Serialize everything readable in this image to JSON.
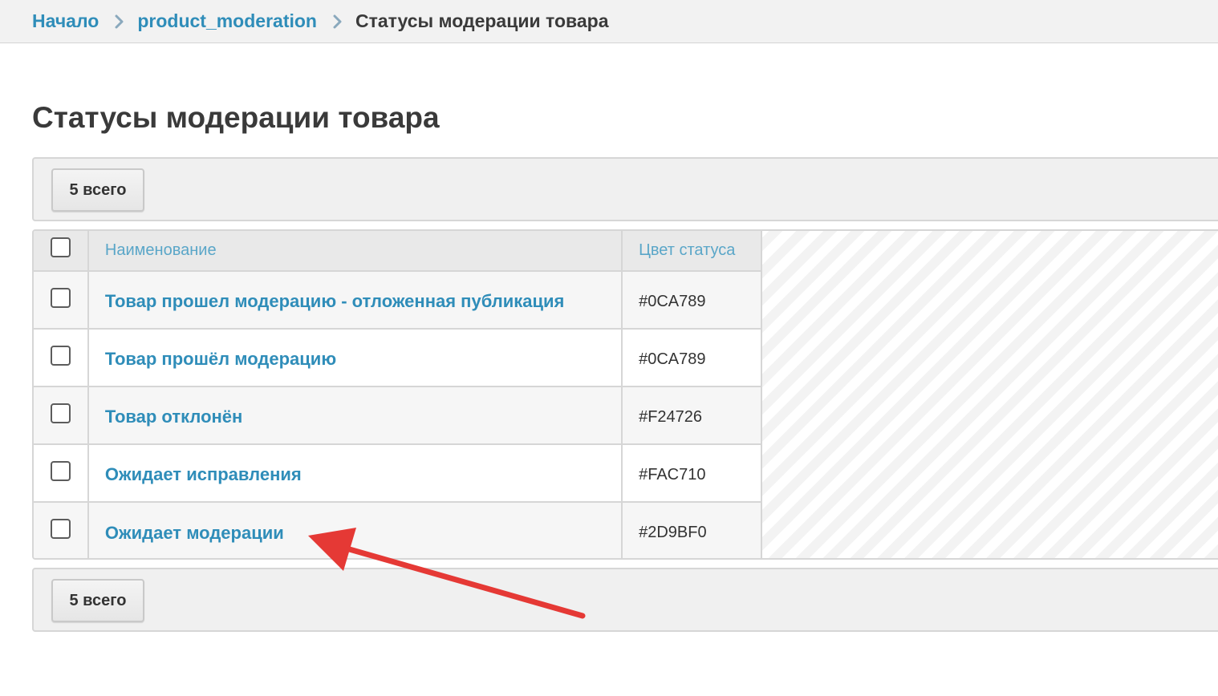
{
  "breadcrumb": {
    "items": [
      "Начало",
      "product_moderation"
    ],
    "current": "Статусы модерации товара"
  },
  "page": {
    "title": "Статусы модерации товара"
  },
  "toolbar": {
    "count_label": "5 всего"
  },
  "table": {
    "columns": [
      "Наименование",
      "Цвет статуса"
    ],
    "rows": [
      {
        "name": "Товар прошел модерацию - отложенная публикация",
        "color": "#0CA789"
      },
      {
        "name": "Товар прошёл модерацию",
        "color": "#0CA789"
      },
      {
        "name": "Товар отклонён",
        "color": "#F24726"
      },
      {
        "name": "Ожидает исправления",
        "color": "#FAC710"
      },
      {
        "name": "Ожидает модерации",
        "color": "#2D9BF0"
      }
    ]
  },
  "colors": {
    "link": "#2f8db9",
    "header_text": "#5aa6c8",
    "annotation_arrow": "#e53935"
  },
  "icons": {
    "breadcrumb_separator": "chevron-right-icon",
    "annotation": "arrow-pointer-icon"
  }
}
